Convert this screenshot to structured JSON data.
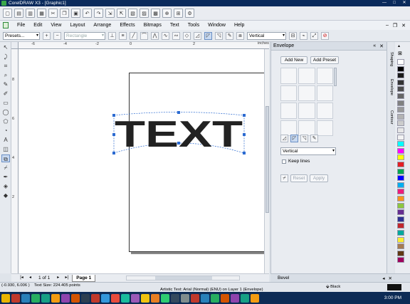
{
  "title": "CorelDRAW X3 - [Graphic1]",
  "menu": [
    "File",
    "Edit",
    "View",
    "Layout",
    "Arrange",
    "Effects",
    "Bitmaps",
    "Text",
    "Tools",
    "Window",
    "Help"
  ],
  "propbar": {
    "presets": "Presets...",
    "shape": "Rectangle",
    "mapping": "Vertical"
  },
  "ruler": {
    "top_unit": "inches",
    "top_ticks": [
      "-6",
      "-4",
      "-2",
      "0",
      "2"
    ],
    "left_ticks": [
      "8",
      "6",
      "4",
      "2"
    ]
  },
  "canvas": {
    "text": "TEXT"
  },
  "docker": {
    "title": "Envelope",
    "add_new": "Add New",
    "add_preset": "Add Preset",
    "mapping_mode": "Vertical",
    "keep_lines": "Keep lines",
    "reset": "Reset",
    "apply": "Apply"
  },
  "side_tabs": [
    "Shaping",
    "Envelope",
    "Contour"
  ],
  "nav": {
    "page_count": "1 of 1",
    "page_tab": "Page 1"
  },
  "bevel": "Bevel",
  "status": {
    "coords": "(-0.930, 6.006 )",
    "text_size": "Text Size: 224.405 points",
    "object_info": "Artistic Text: Arial (Normal) (ENU) on Layer 1 (Envelope)",
    "fill": "Black"
  },
  "taskbar": {
    "clock": "3:00 PM"
  },
  "palette_colors": [
    "#ffffff",
    "#000000",
    "#1a1a1a",
    "#333333",
    "#4d4d4d",
    "#666666",
    "#808080",
    "#999999",
    "#b3b3b3",
    "#cccccc",
    "#e6e6e6",
    "#f2f2f2",
    "#00ffff",
    "#ff00ff",
    "#ffff00",
    "#e31e24",
    "#00a651",
    "#0000ff",
    "#00aeef",
    "#ed1c7b",
    "#f7941d",
    "#8dc63f",
    "#662d91",
    "#2e3192",
    "#c1272d",
    "#00a99d",
    "#f9ed32",
    "#a67c52",
    "#603913",
    "#9e005d"
  ]
}
